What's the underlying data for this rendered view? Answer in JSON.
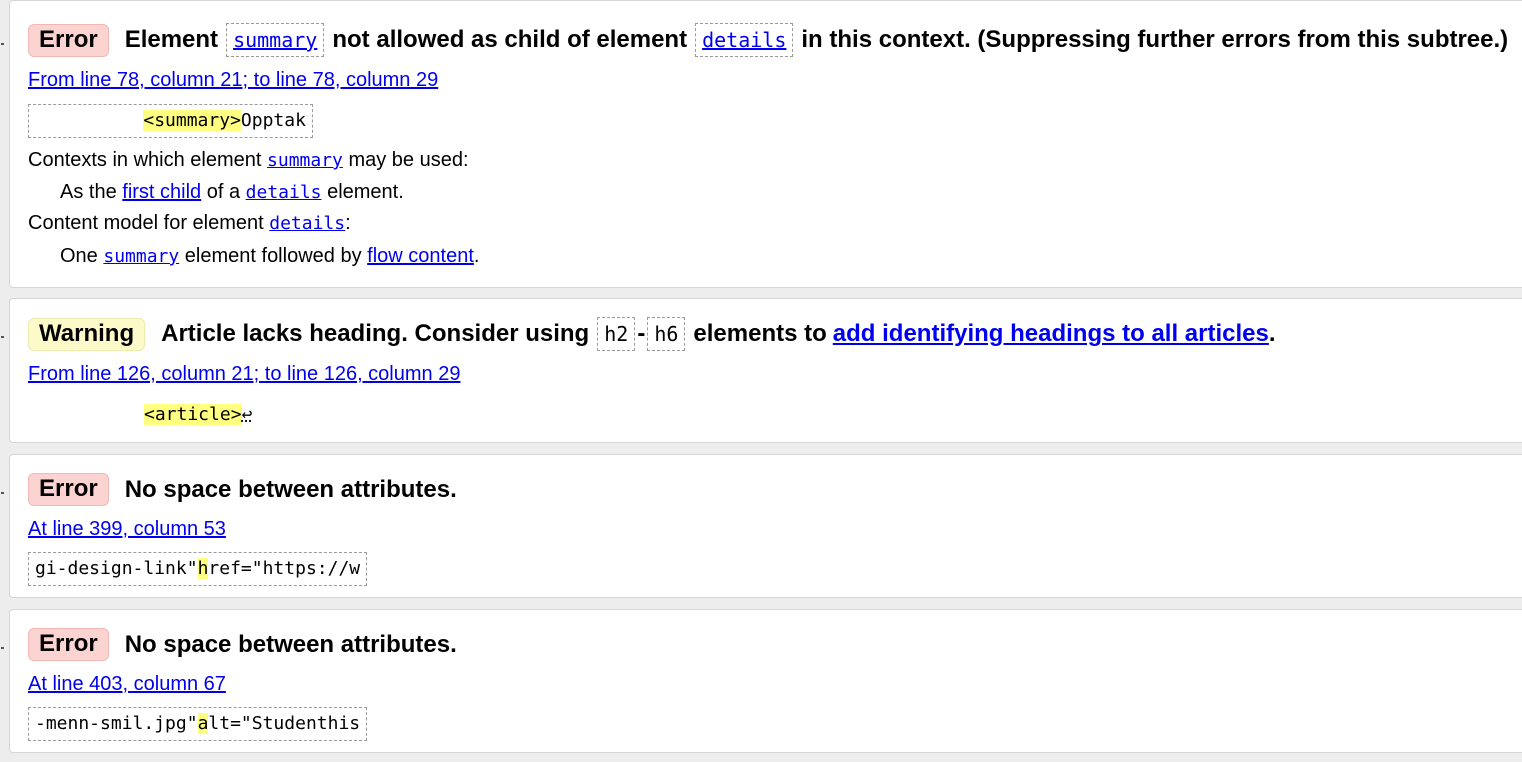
{
  "messages": [
    {
      "type": "Error",
      "title_parts": [
        "Element",
        "summary",
        "not allowed as child of element",
        "details",
        "in this context. (Suppressing further errors from this subtree.)"
      ],
      "location": "From line 78, column 21; to line 78, column 29",
      "extract_prefix": "          ",
      "extract_highlight": "<summary>",
      "extract_suffix": "Opptak",
      "contexts_label_a": "Contexts in which element",
      "contexts_code": "summary",
      "contexts_label_b": "may be used:",
      "contexts_item_a": "As the",
      "contexts_item_link": "first child",
      "contexts_item_b": "of a",
      "contexts_item_code": "details",
      "contexts_item_c": "element.",
      "content_label_a": "Content model for element",
      "content_code": "details",
      "content_label_b": ":",
      "content_item_a": "One",
      "content_item_code": "summary",
      "content_item_b": "element followed by",
      "content_item_link": "flow content",
      "content_item_c": "."
    },
    {
      "type": "Warning",
      "title_a": "Article lacks heading. Consider using",
      "title_code_1": "h2",
      "title_dash": "-",
      "title_code_2": "h6",
      "title_b": "elements to",
      "title_link": "add identifying headings to all articles",
      "title_c": ".",
      "location": "From line 126, column 21; to line 126, column 29",
      "extract_highlight": "<article>",
      "extract_suffix": "↩"
    },
    {
      "type": "Error",
      "title": "No space between attributes.",
      "location": "At line 399, column 53",
      "extract_prefix": "gi-design-link\"",
      "extract_highlight": "h",
      "extract_suffix": "ref=\"https://w"
    },
    {
      "type": "Error",
      "title": "No space between attributes.",
      "location": "At line 403, column 67",
      "extract_prefix": "-menn-smil.jpg\"",
      "extract_highlight": "a",
      "extract_suffix": "lt=\"Studenthis"
    }
  ]
}
